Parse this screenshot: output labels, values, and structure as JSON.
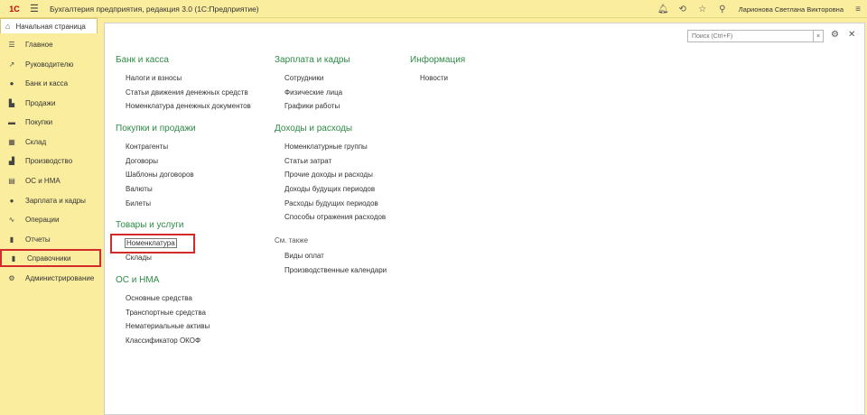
{
  "titlebar": {
    "logo": "1C",
    "title": "Бухгалтерия предприятия, редакция 3.0  (1С:Предприятие)",
    "username": "Ларионова Светлана Викторовна"
  },
  "tabs": {
    "home": "Начальная страница"
  },
  "sidebar": {
    "items": [
      {
        "label": "Главное",
        "icon": "menu-icon"
      },
      {
        "label": "Руководителю",
        "icon": "trend-icon"
      },
      {
        "label": "Банк и касса",
        "icon": "bank-icon"
      },
      {
        "label": "Продажи",
        "icon": "cart-icon"
      },
      {
        "label": "Покупки",
        "icon": "basket-icon"
      },
      {
        "label": "Склад",
        "icon": "warehouse-icon"
      },
      {
        "label": "Производство",
        "icon": "factory-icon"
      },
      {
        "label": "ОС и НМА",
        "icon": "assets-icon"
      },
      {
        "label": "Зарплата и кадры",
        "icon": "person-icon"
      },
      {
        "label": "Операции",
        "icon": "operations-icon"
      },
      {
        "label": "Отчеты",
        "icon": "chart-icon"
      },
      {
        "label": "Справочники",
        "icon": "book-icon"
      },
      {
        "label": "Администрирование",
        "icon": "gear-icon"
      }
    ]
  },
  "search": {
    "placeholder": "Поиск (Ctrl+F)"
  },
  "columns": {
    "col1": {
      "bank": {
        "title": "Банк и касса",
        "links": [
          "Налоги и взносы",
          "Статьи движения денежных средств",
          "Номенклатура денежных документов"
        ]
      },
      "purchases": {
        "title": "Покупки и продажи",
        "links": [
          "Контрагенты",
          "Договоры",
          "Шаблоны договоров",
          "Валюты",
          "Билеты"
        ]
      },
      "goods": {
        "title": "Товары и услуги",
        "links": [
          "Номенклатура",
          "Склады"
        ]
      },
      "assets": {
        "title": "ОС и НМА",
        "links": [
          "Основные средства",
          "Транспортные средства",
          "Нематериальные активы",
          "Классификатор ОКОФ"
        ]
      }
    },
    "col2": {
      "salary": {
        "title": "Зарплата и кадры",
        "links": [
          "Сотрудники",
          "Физические лица",
          "Графики работы"
        ]
      },
      "income": {
        "title": "Доходы и расходы",
        "links": [
          "Номенклатурные группы",
          "Статьи затрат",
          "Прочие доходы и расходы",
          "Доходы будущих периодов",
          "Расходы будущих периодов",
          "Способы отражения расходов"
        ]
      },
      "seealso": {
        "title": "См. также",
        "links": [
          "Виды оплат",
          "Производственные календари"
        ]
      }
    },
    "col3": {
      "info": {
        "title": "Информация",
        "links": [
          "Новости"
        ]
      }
    }
  }
}
